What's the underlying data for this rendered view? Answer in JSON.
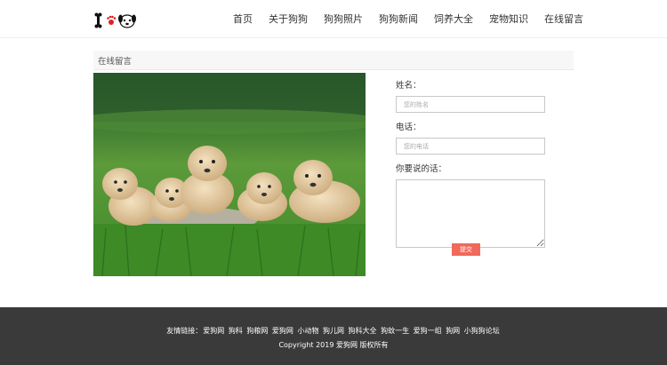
{
  "header": {
    "nav": [
      "首页",
      "关于狗狗",
      "狗狗照片",
      "狗狗新闻",
      "饲养大全",
      "宠物知识",
      "在线留言"
    ]
  },
  "section": {
    "title": "在线留言"
  },
  "form": {
    "name_label": "姓名：",
    "name_placeholder": "您的姓名",
    "phone_label": "电话：",
    "phone_placeholder": "您的电话",
    "message_label": "你要说的话：",
    "submit_label": "提交"
  },
  "footer": {
    "links_label": "友情链接：",
    "links": [
      "爱狗网",
      "狗科",
      "狗粮网",
      "爱狗网",
      "小动物",
      "狗儿网",
      "狗科大全",
      "狗蚊一生",
      "爱狗一组",
      "狗网",
      "小狗狗论坛"
    ],
    "copyright": "Copyright 2019 爱狗网 版权所有"
  },
  "colors": {
    "submit": "#f0695a",
    "footer_bg": "#3a3a3a"
  },
  "icons": {
    "logo": "i-love-dog-logo"
  }
}
